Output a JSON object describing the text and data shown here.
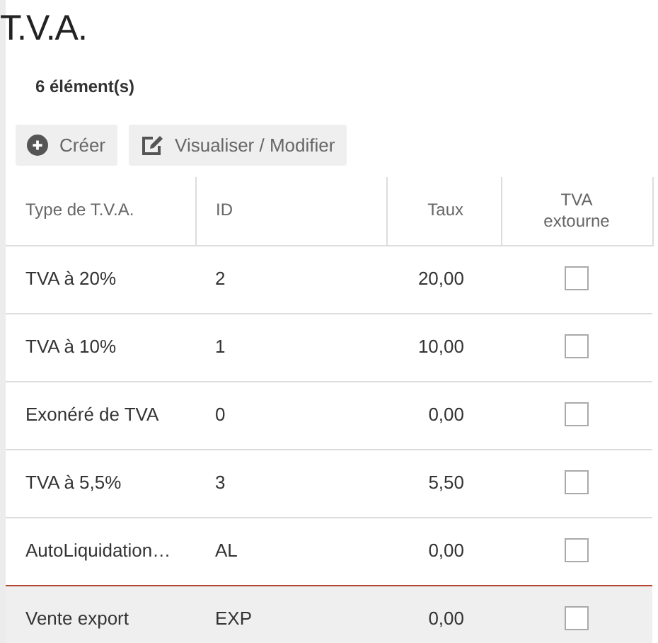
{
  "title": "T.V.A.",
  "count": "6 élément(s)",
  "buttons": [
    {
      "label": "Créer",
      "kind": "create"
    },
    {
      "label": "Visualiser / Modifier",
      "kind": "edit"
    }
  ],
  "table": {
    "columns": [
      "Type de T.V.A.",
      "ID",
      "Taux",
      "TVA extourne"
    ],
    "rows": [
      {
        "type": "TVA à 20%",
        "id": "2",
        "rate": "20,00",
        "reverse": false,
        "selected": false
      },
      {
        "type": "TVA à 10%",
        "id": "1",
        "rate": "10,00",
        "reverse": false,
        "selected": false
      },
      {
        "type": "Exonéré de TVA",
        "id": "0",
        "rate": "0,00",
        "reverse": false,
        "selected": false
      },
      {
        "type": "TVA à 5,5%",
        "id": "3",
        "rate": "5,50",
        "reverse": false,
        "selected": false
      },
      {
        "type": "AutoLiquidation…",
        "id": "AL",
        "rate": "0,00",
        "reverse": false,
        "selected": false
      },
      {
        "type": "Vente export",
        "id": "EXP",
        "rate": "0,00",
        "reverse": false,
        "selected": true
      }
    ]
  }
}
